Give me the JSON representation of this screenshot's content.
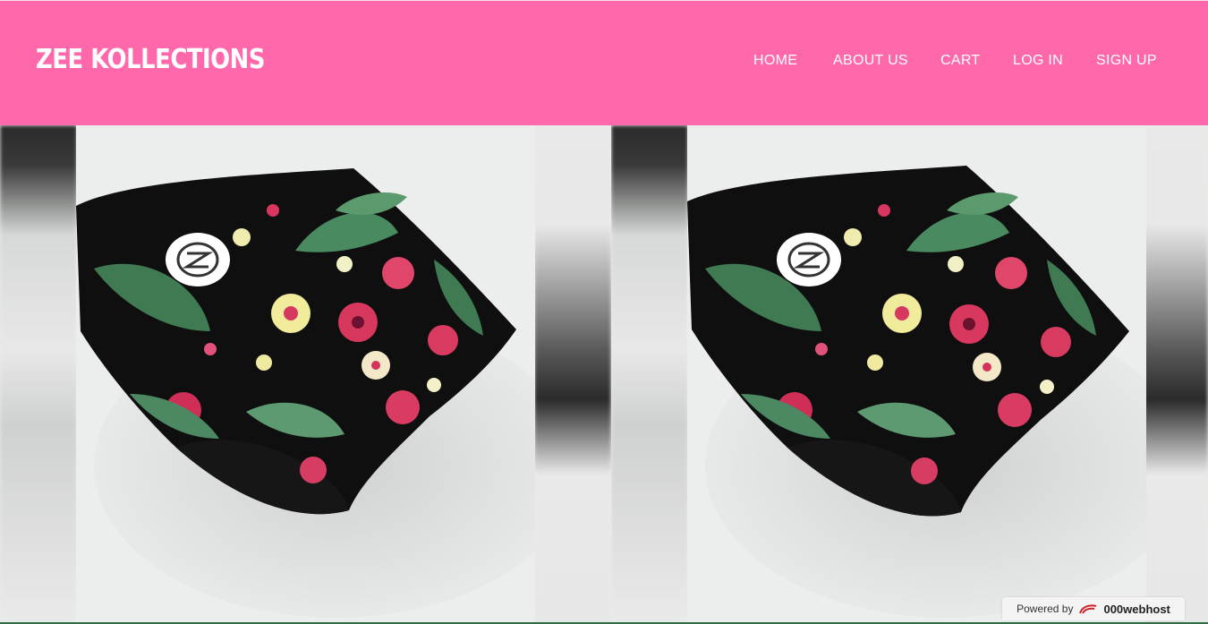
{
  "brand": {
    "name": "ZEE KOLLECTIONS"
  },
  "nav": {
    "home": "HOME",
    "about": "ABOUT US",
    "cart": "CART",
    "login": "LOG IN",
    "signup": "SIGN UP"
  },
  "gallery": {
    "items": [
      {
        "alt": "Floral print fabric with logo"
      },
      {
        "alt": "Floral print fabric with logo"
      }
    ]
  },
  "footer_badge": {
    "powered": "Powered by",
    "host": "000webhost"
  },
  "colors": {
    "header": "#ff69ab",
    "fabric": "#0f0f10",
    "background": "#eceeed"
  }
}
